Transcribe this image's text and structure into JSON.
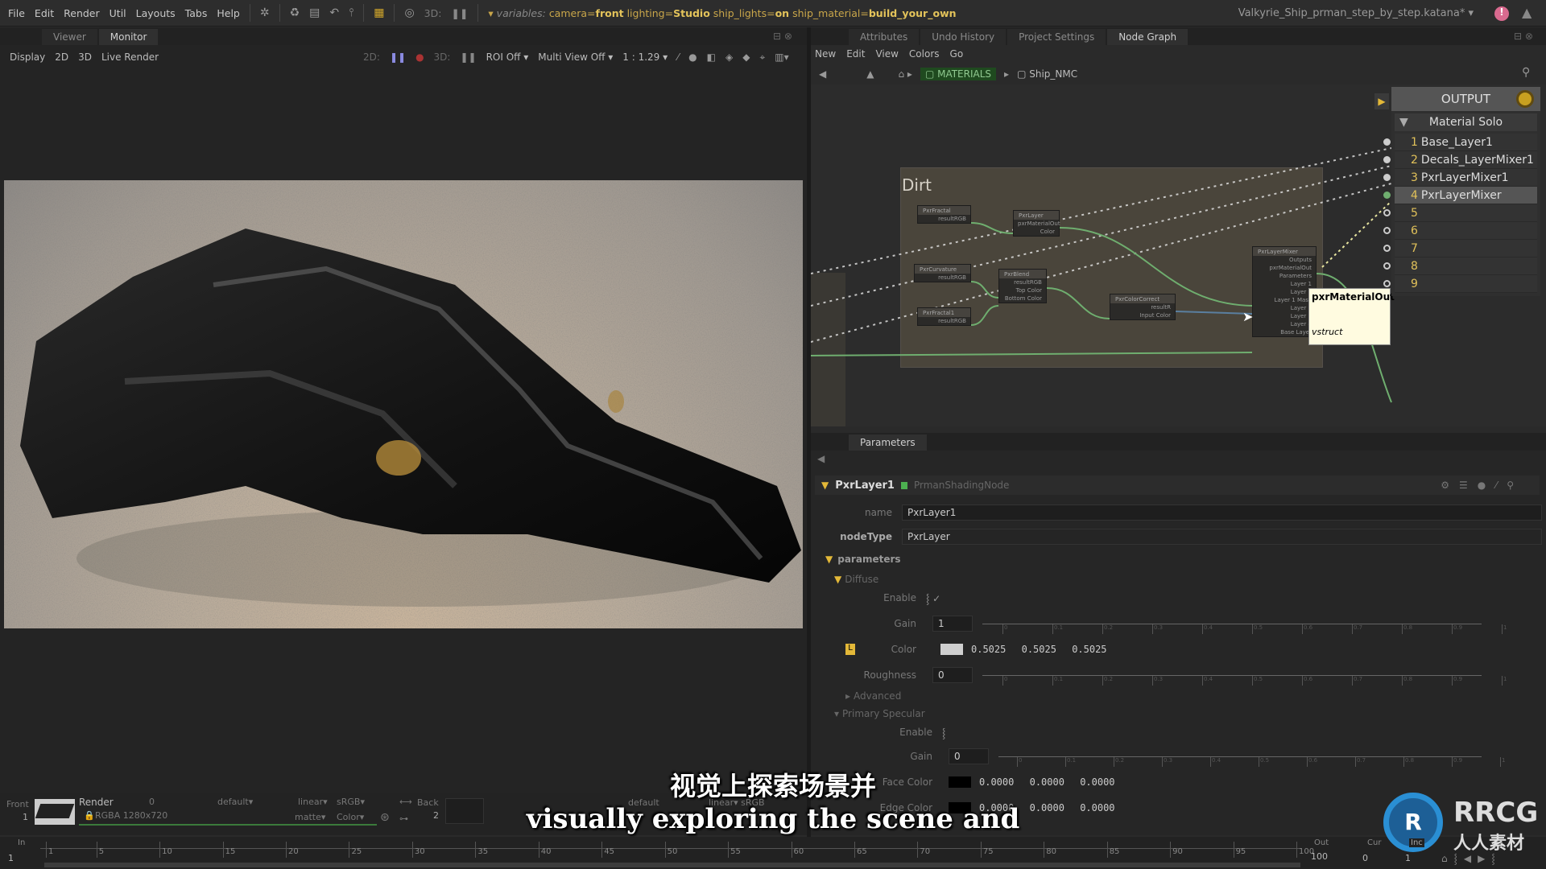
{
  "menu": {
    "items": [
      "File",
      "Edit",
      "Render",
      "Util",
      "Layouts",
      "Tabs",
      "Help"
    ],
    "threed_label": "3D:",
    "variables_label": "variables:",
    "variables": [
      {
        "key": "camera",
        "value": "front"
      },
      {
        "key": "lighting",
        "value": "Studio"
      },
      {
        "key": "ship_lights",
        "value": "on"
      },
      {
        "key": "ship_material",
        "value": "build_your_own"
      }
    ],
    "project_title": "Valkyrie_Ship_prman_step_by_step.katana*"
  },
  "left_panel": {
    "tabs": [
      "Viewer",
      "Monitor"
    ],
    "active_tab": "Monitor",
    "toolbar": {
      "items": [
        "Display",
        "2D",
        "3D",
        "Live Render"
      ],
      "label_2d": "2D:",
      "label_3d": "3D:",
      "roi": "ROI Off",
      "multi_view": "Multi View Off",
      "zoom": "1 : 1.29"
    }
  },
  "monitor_strip": {
    "front_label": "Front",
    "front_value": "1",
    "render_label": "Render",
    "render_value": "0",
    "channels": "RGBA 1280x720",
    "default": "default",
    "linear": "linear",
    "srgb": "sRGB",
    "matte": "matte",
    "color": "Color",
    "back_label": "Back",
    "back_value": "2",
    "default2": "default",
    "linear2": "linear",
    "srgb2": "sRGB"
  },
  "right_panel": {
    "tabs": [
      "Attributes",
      "Undo History",
      "Project Settings",
      "Node Graph"
    ],
    "active_tab": "Node Graph",
    "menu": [
      "New",
      "Edit",
      "View",
      "Colors",
      "Go"
    ],
    "breadcrumb": [
      "MATERIALS",
      "Ship_NMC"
    ]
  },
  "node_graph": {
    "backdrop_label": "Dirt",
    "nodes": {
      "fractal": {
        "title": "PxrFractal",
        "ports": [
          "resultRGB"
        ]
      },
      "layer": {
        "title": "PxrLayer",
        "ports": [
          "pxrMaterialOut",
          "Color"
        ]
      },
      "curvature": {
        "title": "PxrCurvature",
        "ports": [
          "resultRGB"
        ]
      },
      "blend": {
        "title": "PxrBlend",
        "ports": [
          "resultRGB",
          "Top Color",
          "Bottom Color"
        ]
      },
      "fractal1": {
        "title": "PxrFractal1",
        "ports": [
          "resultRGB"
        ]
      },
      "colorcorrect": {
        "title": "PxrColorCorrect",
        "ports": [
          "resultR",
          "Input Color"
        ]
      },
      "mixer": {
        "title": "PxrLayerMixer",
        "ports": [
          "Outputs",
          "pxrMaterialOut",
          "Parameters",
          "Layer 1",
          "Layer 1",
          "Layer 1 Mask",
          "Layer 2",
          "Layer 3",
          "Layer 4",
          "Base Layer"
        ]
      }
    },
    "tooltip": {
      "title": "pxrMaterialOut",
      "type": "vstruct"
    },
    "output": {
      "title": "OUTPUT",
      "mode": "Material Solo",
      "rows": [
        {
          "n": "1",
          "label": "Base_Layer1"
        },
        {
          "n": "2",
          "label": "Decals_LayerMixer1"
        },
        {
          "n": "3",
          "label": "PxrLayerMixer1"
        },
        {
          "n": "4",
          "label": "PxrLayerMixer"
        },
        {
          "n": "5",
          "label": ""
        },
        {
          "n": "6",
          "label": ""
        },
        {
          "n": "7",
          "label": ""
        },
        {
          "n": "8",
          "label": ""
        },
        {
          "n": "9",
          "label": ""
        }
      ],
      "selected_row": "4"
    }
  },
  "parameters": {
    "tab": "Parameters",
    "node_name": "PxrLayer1",
    "node_class": "PrmanShadingNode",
    "name_label": "name",
    "name_value": "PxrLayer1",
    "nodetype_label": "nodeType",
    "nodetype_value": "PxrLayer",
    "group": "parameters",
    "diffuse": "Diffuse",
    "d_enable": "Enable",
    "d_gain": "Gain",
    "d_gain_value": "1",
    "d_color": "Color",
    "d_color_values": [
      "0.5025",
      "0.5025",
      "0.5025"
    ],
    "d_roughness": "Roughness",
    "d_roughness_value": "0",
    "advanced": "Advanced",
    "specular": "Primary Specular",
    "s_enable": "Enable",
    "s_gain": "Gain",
    "s_gain_value": "0",
    "face_color": "Face Color",
    "face_values": [
      "0.0000",
      "0.0000",
      "0.0000"
    ],
    "edge_color": "Edge Color",
    "edge_values": [
      "0.0000",
      "0.0000",
      "0.0000"
    ],
    "slider_ticks": [
      "0",
      "0.1",
      "0.2",
      "0.3",
      "0.4",
      "0.5",
      "0.6",
      "0.7",
      "0.8",
      "0.9",
      "1"
    ]
  },
  "timeline": {
    "in_label": "In",
    "in_value": "1",
    "out_label": "Out",
    "out_value": "100",
    "cur_label": "Cur",
    "cur_value": "0",
    "inc_label": "Inc",
    "inc_value": "1",
    "ticks": [
      "1",
      "5",
      "10",
      "15",
      "20",
      "25",
      "30",
      "35",
      "40",
      "45",
      "50",
      "55",
      "60",
      "65",
      "70",
      "75",
      "80",
      "85",
      "90",
      "95",
      "100"
    ]
  },
  "subtitles": {
    "zh": "视觉上探索场景并",
    "en": "visually exploring the scene and"
  },
  "watermark": {
    "text": "RRCG",
    "sub": "人人素材"
  }
}
